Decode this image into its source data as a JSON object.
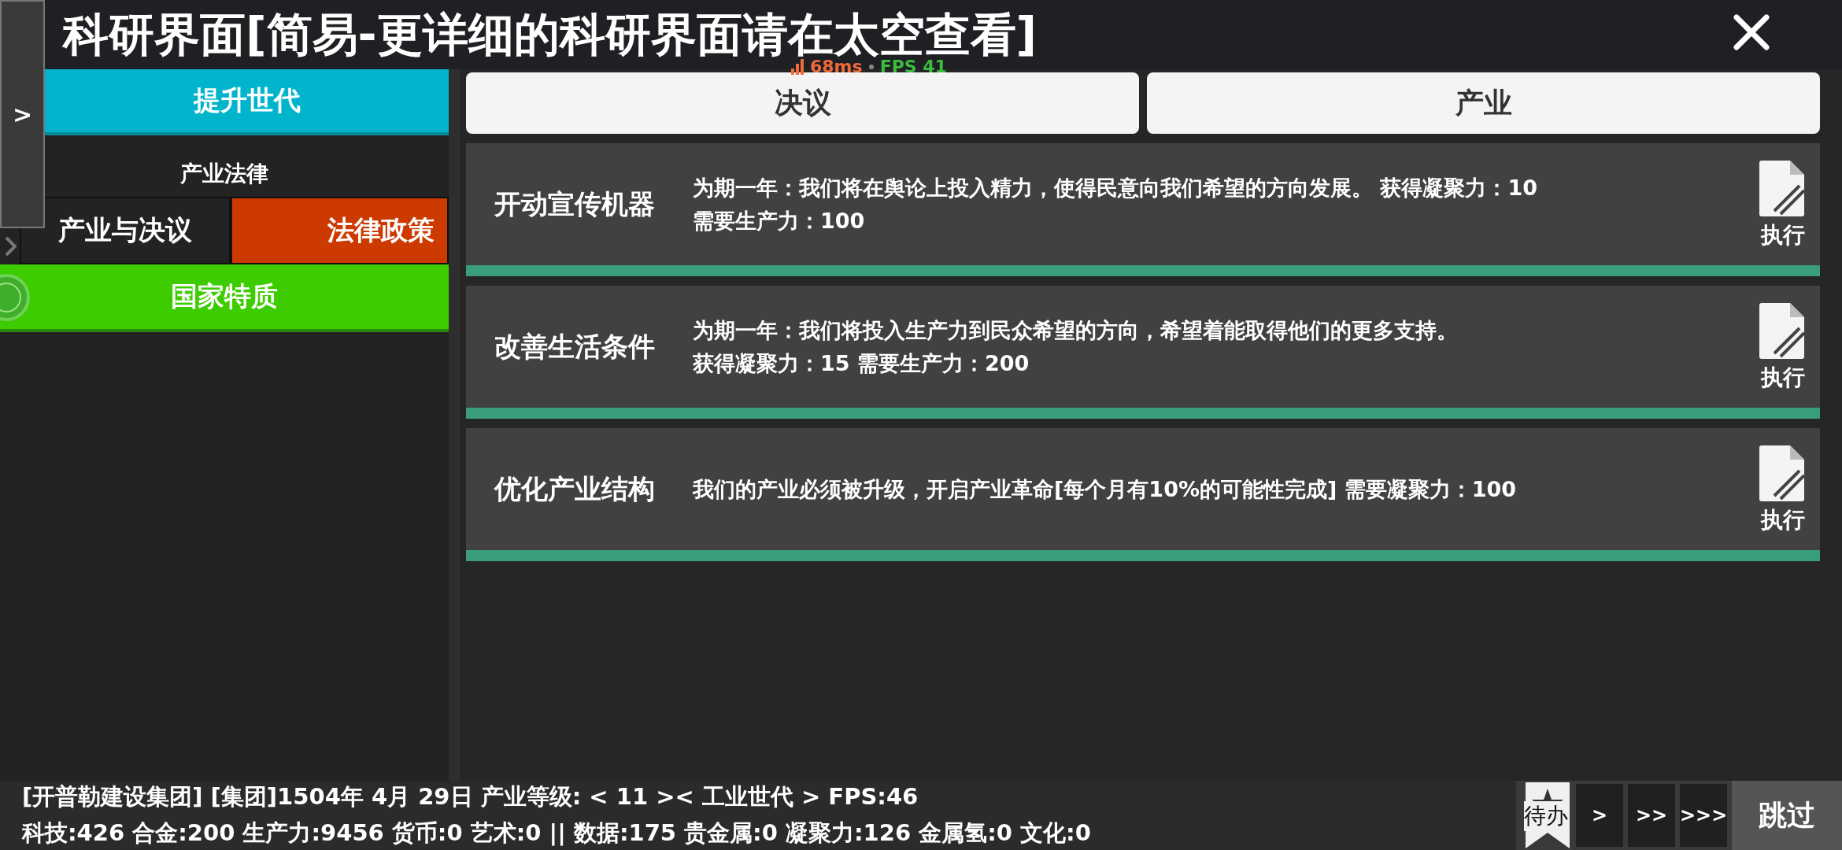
{
  "window": {
    "title": "科研界面[简易-更详细的科研界面请在太空查看]"
  },
  "overlay": {
    "latency": "68ms",
    "fps": "FPS 41"
  },
  "side_toggle": ">",
  "sidebar": {
    "upgrade_button": "提升世代",
    "section_label": "产业法律",
    "tabs": [
      {
        "label": "产业与决议",
        "color": "#232323"
      },
      {
        "label": "法律政策",
        "color": "#cc3a00"
      }
    ],
    "traits_button": "国家特质"
  },
  "tabs": [
    {
      "label": "决议"
    },
    {
      "label": "产业"
    }
  ],
  "actions": [
    {
      "name": "开动宣传机器",
      "description": [
        "为期一年：我们将在舆论上投入精力，使得民意向我们希望的方向发展。 获得凝聚力：10",
        "需要生产力：100"
      ],
      "button": "执行"
    },
    {
      "name": "改善生活条件",
      "description": [
        "为期一年：我们将投入生产力到民众希望的方向，希望着能取得他们的更多支持。",
        "获得凝聚力：15 需要生产力：200"
      ],
      "button": "执行"
    },
    {
      "name": "优化产业结构",
      "description": [
        "我们的产业必须被升级，开启产业革命[每个月有10%的可能性完成] 需要凝聚力：100"
      ],
      "button": "执行"
    }
  ],
  "status_bar": {
    "lines": [
      "[开普勒建设集团] [集团]1504年 4月 29日 产业等级: < 11 >< 工业世代 > FPS:46",
      "科技:426 合金:200 生产力:9456 货币:0 艺术:0 || 数据:175 贵金属:0 凝聚力:126 金属氢:0 文化:0"
    ],
    "todo": "待办",
    "speeds": [
      ">",
      ">>",
      ">>>"
    ],
    "skip": "跳过"
  }
}
